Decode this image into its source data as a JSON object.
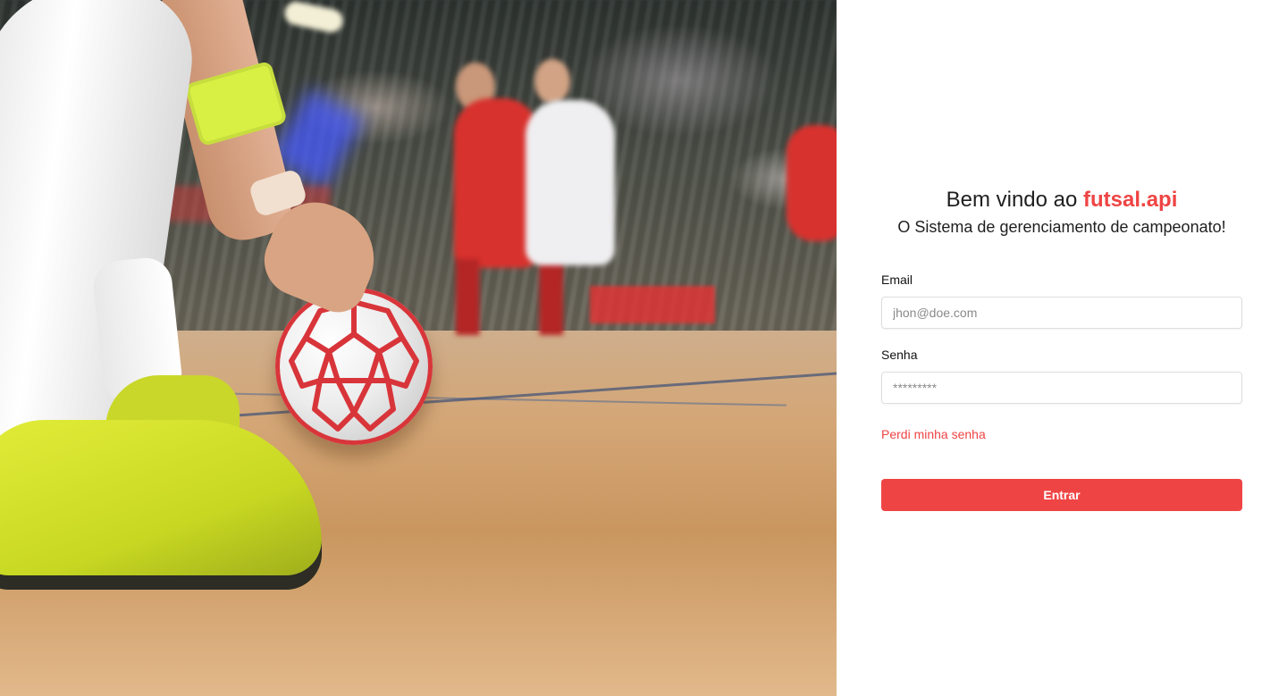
{
  "hero": {
    "image_description_icon": "futsal-photo"
  },
  "login": {
    "heading_prefix": "Bem vindo ao ",
    "heading_brand": "futsal.api",
    "subheading": "O Sistema de gerenciamento de campeonato!",
    "email_label": "Email",
    "email_placeholder": "jhon@doe.com",
    "password_label": "Senha",
    "password_placeholder": "*********",
    "forgot_link": "Perdi minha senha",
    "submit_label": "Entrar"
  },
  "colors": {
    "accent": "#ef4444",
    "text": "#1f1f1f",
    "input_border": "#dedede"
  }
}
